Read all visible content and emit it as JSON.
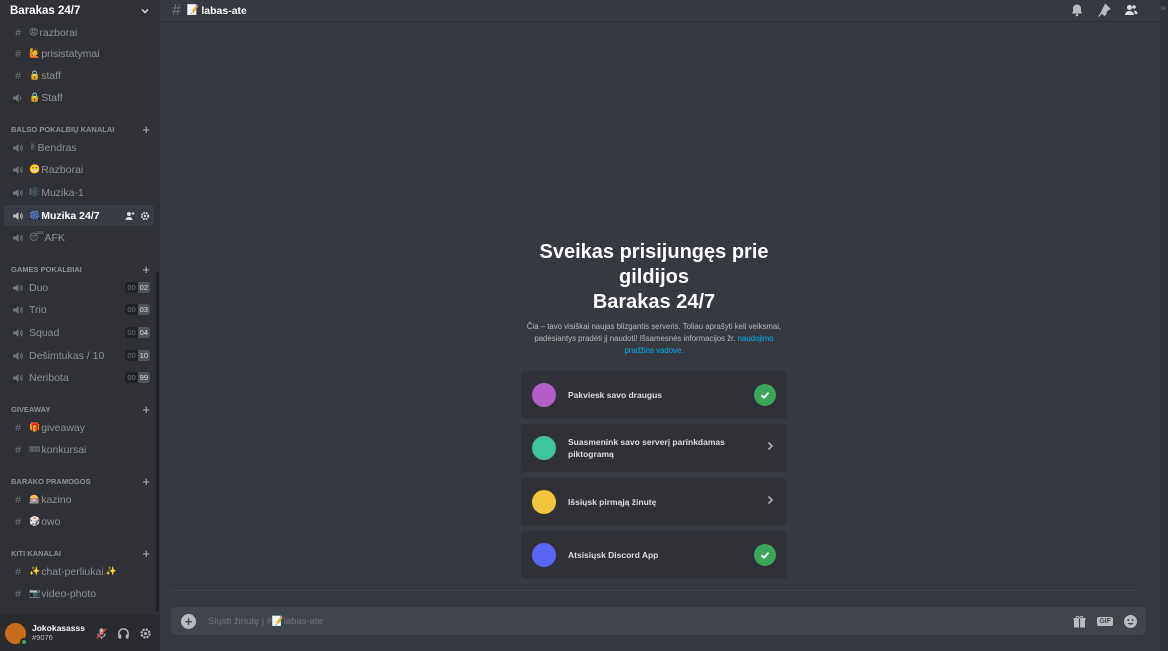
{
  "server": {
    "name": "Barakas 24/7"
  },
  "channels_top": [
    {
      "emoji": "😡",
      "label": "razborai",
      "type": "text"
    },
    {
      "emoji": "🙋",
      "label": "prisistatymai",
      "type": "text"
    },
    {
      "emoji": "🔒",
      "label": "staff",
      "type": "text-locked"
    },
    {
      "emoji": "🔒",
      "label": "Staff",
      "type": "voice-locked"
    }
  ],
  "categories": {
    "voice": "BALSO POKALBIŲ KANALAI",
    "games": "GAMES POKALBIAI",
    "giveaway": "GIVEAWAY",
    "barako": "BARAKO PRAMOGOS",
    "kiti": "KITI KANALAI"
  },
  "voice_channels": [
    {
      "emoji": "✌",
      "label": "Bendras"
    },
    {
      "emoji": "😬",
      "label": "Razborai"
    },
    {
      "emoji": "🎼",
      "label": "Muzika-1"
    },
    {
      "emoji": "🎆",
      "label": "Muzika 24/7",
      "selected": true
    },
    {
      "emoji": "😴",
      "label": "AFK"
    }
  ],
  "game_channels": [
    {
      "label": "Duo",
      "count_a": "00",
      "count_b": "02"
    },
    {
      "label": "Trio",
      "count_a": "00",
      "count_b": "03"
    },
    {
      "label": "Squad",
      "count_a": "00",
      "count_b": "04"
    },
    {
      "label": "Dešimtukas / 10",
      "count_a": "00",
      "count_b": "10"
    },
    {
      "label": "Neribota",
      "count_a": "00",
      "count_b": "99"
    }
  ],
  "giveaway_channels": [
    {
      "emoji": "🎁",
      "label": "giveaway"
    },
    {
      "emoji": "🎟",
      "label": "konkursai"
    }
  ],
  "barako_channels": [
    {
      "emoji": "🎰",
      "label": "kazino"
    },
    {
      "emoji": "🎲",
      "label": "owo"
    }
  ],
  "kiti_channels": [
    {
      "emoji": "✨",
      "label": "chat-perliukai",
      "emoji_after": "✨"
    },
    {
      "emoji": "📷",
      "label": "video-photo"
    }
  ],
  "user": {
    "name": "Jokokasasss",
    "tag": "#9076"
  },
  "topbar": {
    "channel": "labas-ate",
    "doc_emoji": "📝"
  },
  "right_strip_text": "le",
  "welcome": {
    "line1": "Sveikas prisijungęs prie",
    "line2": "gildijos",
    "line3": "Barakas 24/7",
    "desc": "Čia – tavo visiškai naujas blizgantis serveris. Toliau aprašyti keli veiksmai, padėsiantys pradėti jį naudoti! Išsamesnės informacijos žr.",
    "link": "naudojimo pradžios vadove."
  },
  "cards": [
    {
      "label": "Pakviesk savo draugus",
      "state": "done",
      "color": "#b35ec8"
    },
    {
      "label": "Suasmenink savo serverį parinkdamas piktogramą",
      "state": "todo",
      "color": "#3fc8a0"
    },
    {
      "label": "Išsiųsk pirmąją žinutę",
      "state": "todo",
      "color": "#f0c43c"
    },
    {
      "label": "Atsisiųsk Discord App",
      "state": "done",
      "color": "#5865f2"
    }
  ],
  "composer": {
    "placeholder": "Siųsti žinutę į #📝labas-ate"
  },
  "colors": {
    "bg": "#36393f",
    "sidebar": "#2f3136",
    "green": "#3ba55c",
    "link": "#00aff4"
  }
}
